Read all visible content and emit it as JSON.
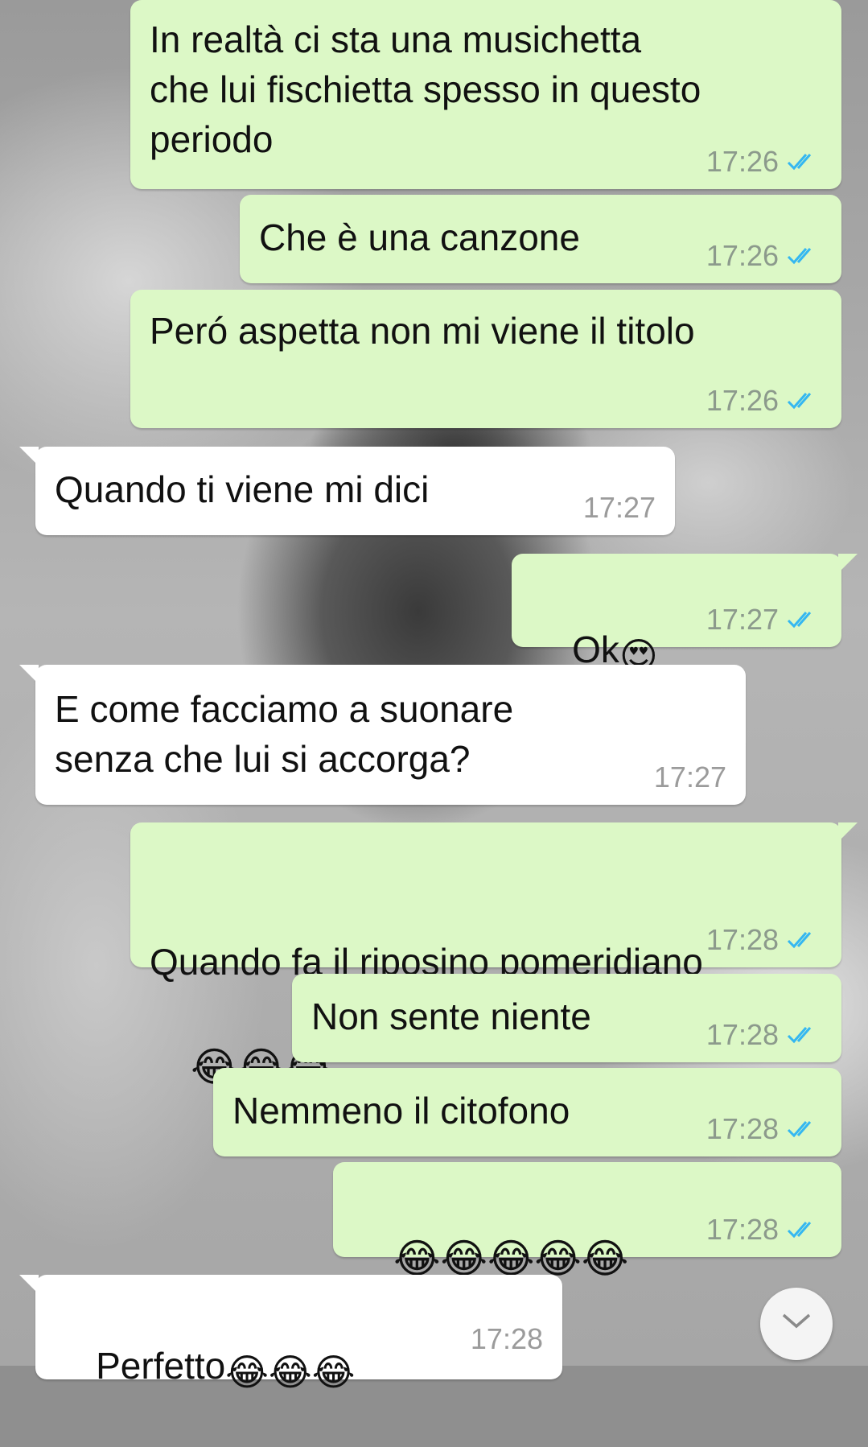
{
  "messages": [
    {
      "dir": "out",
      "text": "In realtà ci sta una musichetta\nche lui fischietta spesso in questo\nperiodo",
      "time": "17:26",
      "status": "read"
    },
    {
      "dir": "out",
      "text": "Che è una canzone",
      "time": "17:26",
      "status": "read"
    },
    {
      "dir": "out",
      "text": "Peró aspetta non mi viene il titolo",
      "time": "17:26",
      "status": "read"
    },
    {
      "dir": "in",
      "text": "Quando ti viene mi dici",
      "time": "17:27"
    },
    {
      "dir": "out",
      "text": "Ok",
      "emoji": "😍",
      "time": "17:27",
      "status": "read"
    },
    {
      "dir": "in",
      "text": "E come facciamo a suonare\nsenza che lui si accorga?",
      "time": "17:27"
    },
    {
      "dir": "out",
      "text": "Quando fa il riposino pomeridiano",
      "emoji_line": "😂😂😂",
      "time": "17:28",
      "status": "read"
    },
    {
      "dir": "out",
      "text": "Non sente niente",
      "time": "17:28",
      "status": "read"
    },
    {
      "dir": "out",
      "text": "Nemmeno il citofono",
      "time": "17:28",
      "status": "read"
    },
    {
      "dir": "out",
      "text": "",
      "emoji_line": "😂😂😂😂😂",
      "time": "17:28",
      "status": "read"
    },
    {
      "dir": "in",
      "text": "Perfetto",
      "emoji": "😂😂😂",
      "time": "17:28"
    }
  ],
  "icons": {
    "read_ticks": "double-check-icon",
    "scroll_down": "chevron-down-icon"
  },
  "colors": {
    "outgoing_bubble": "#dcf8c6",
    "incoming_bubble": "#ffffff",
    "read_ticks": "#34b7f1",
    "timestamp": "#8c9a8c"
  }
}
